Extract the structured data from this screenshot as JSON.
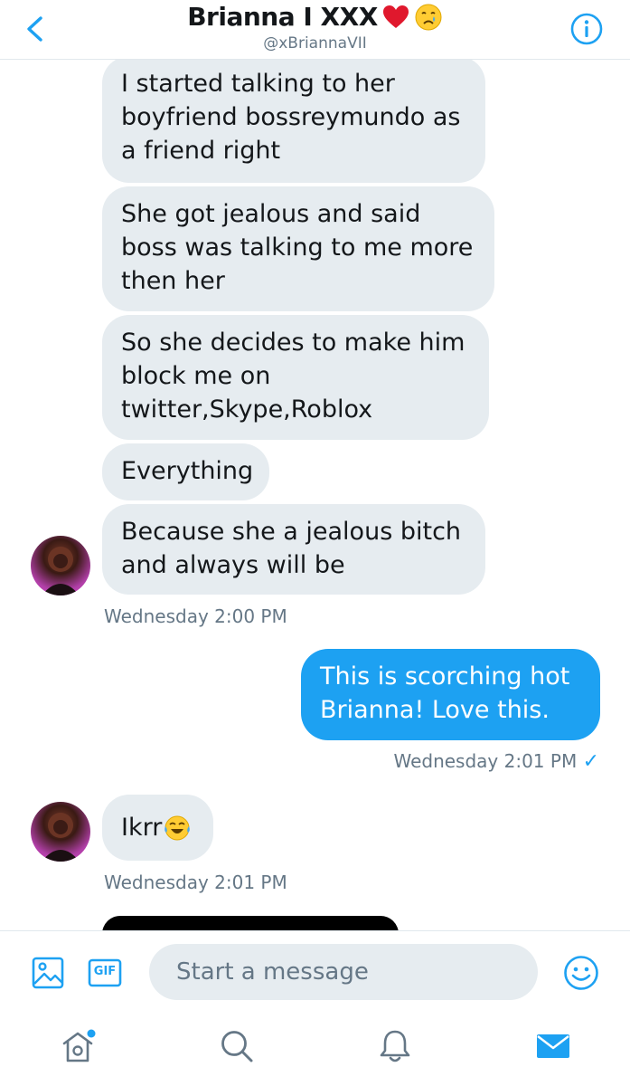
{
  "header": {
    "title": "Brianna I XXX",
    "handle": "@xBriannaVII"
  },
  "messages": {
    "in_group_1": [
      "I started talking to her\nboyfriend bossreymundo as\na friend right",
      "She got jealous and said\nboss was talking to me more\nthen her",
      "So she decides to make him\nblock me on\ntwitter,Skype,Roblox",
      "Everything",
      "Because she a jealous bitch\nand always will be"
    ],
    "in_group_1_time": "Wednesday 2:00 PM",
    "out_1": "This is scorching hot\nBrianna! Love this.",
    "out_1_time": "Wednesday 2:01 PM",
    "out_1_status": "✓",
    "in_2": "Ikrr",
    "in_2_time": "Wednesday 2:01 PM"
  },
  "composer": {
    "placeholder": "Start a message",
    "gif_label": "GIF"
  },
  "colors": {
    "accent": "#1da1f2",
    "incoming_bubble": "#e6ecf0",
    "secondary_text": "#657786"
  },
  "icons": {
    "back": "chevron-left-icon",
    "info": "info-icon",
    "image": "image-icon",
    "gif": "gif-icon",
    "emoji": "smiley-icon",
    "home": "home-icon",
    "search": "search-icon",
    "notifications": "bell-icon",
    "messages": "envelope-icon"
  }
}
